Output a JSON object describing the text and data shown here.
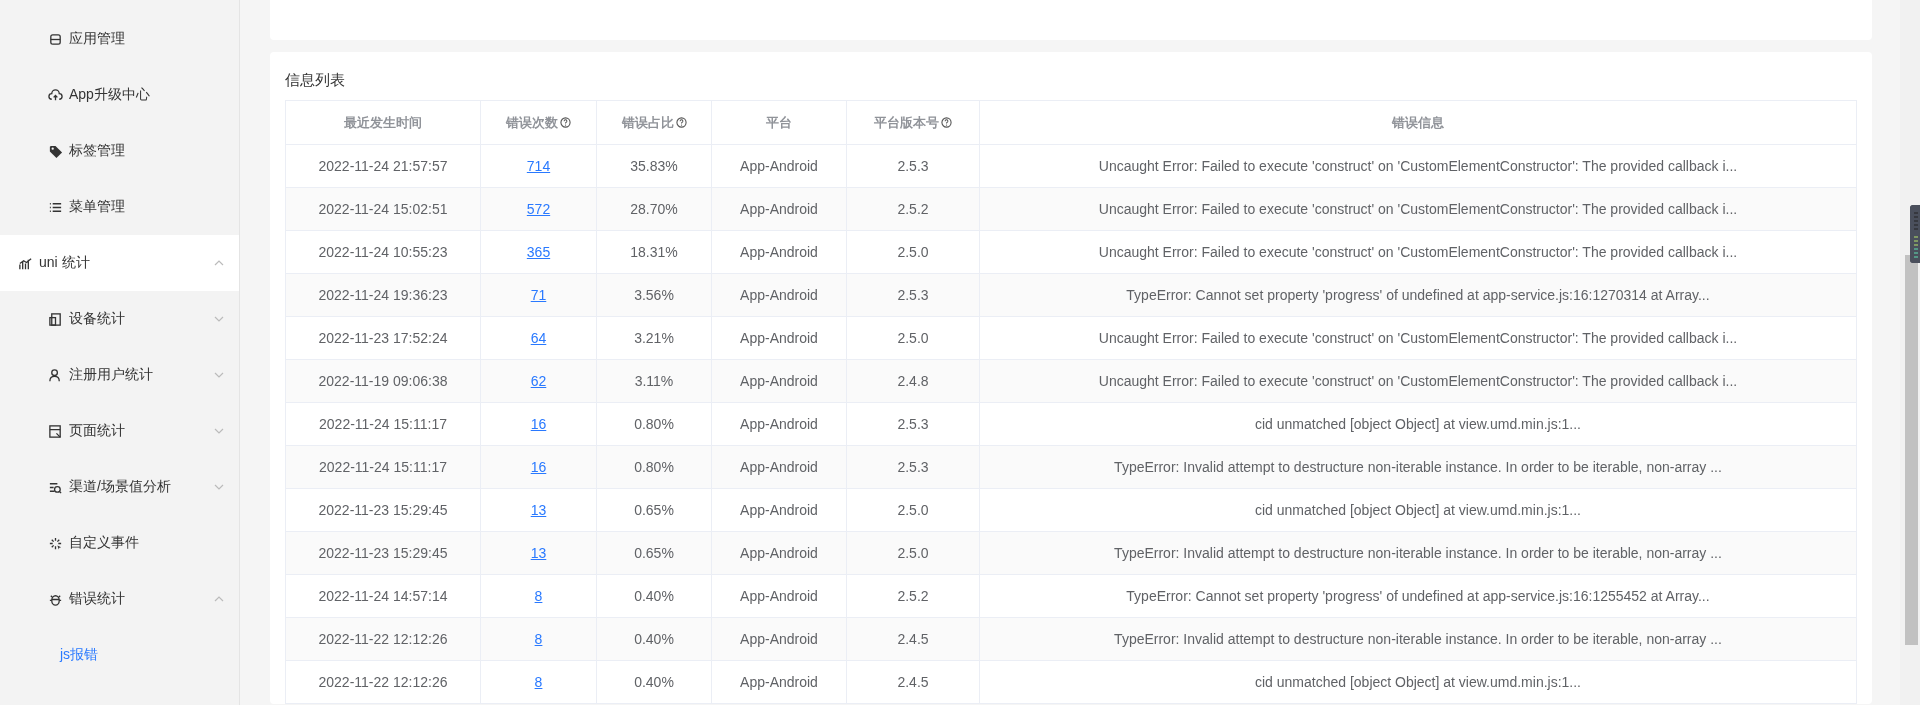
{
  "sidebar": {
    "items": [
      {
        "label": "应用管理",
        "kind": "link",
        "selected": false
      },
      {
        "label": "App升级中心",
        "kind": "link",
        "selected": false
      },
      {
        "label": "标签管理",
        "kind": "link",
        "selected": false
      },
      {
        "label": "菜单管理",
        "kind": "link",
        "selected": false
      },
      {
        "label": "uni 统计",
        "kind": "group",
        "selected": false,
        "expanded": true,
        "children": [
          {
            "label": "设备统计",
            "kind": "link",
            "selected": false,
            "expanded": false
          },
          {
            "label": "注册用户统计",
            "kind": "link",
            "selected": false,
            "expanded": false
          },
          {
            "label": "页面统计",
            "kind": "link",
            "selected": false,
            "expanded": false
          },
          {
            "label": "渠道/场景值分析",
            "kind": "link",
            "selected": false,
            "expanded": false
          },
          {
            "label": "自定义事件",
            "kind": "link",
            "selected": false
          },
          {
            "label": "错误统计",
            "kind": "link",
            "selected": false,
            "expanded": true,
            "children": [
              {
                "label": "js报错",
                "kind": "link",
                "selected": true
              }
            ]
          }
        ]
      }
    ]
  },
  "panel": {
    "title": "信息列表",
    "table": {
      "columns": [
        {
          "label": "最近发生时间",
          "help": false
        },
        {
          "label": "错误次数",
          "help": true
        },
        {
          "label": "错误占比",
          "help": true
        },
        {
          "label": "平台",
          "help": false
        },
        {
          "label": "平台版本号",
          "help": true
        },
        {
          "label": "错误信息",
          "help": false
        }
      ],
      "rows": [
        [
          "2022-11-24 21:57:57",
          "714",
          "35.83%",
          "App-Android",
          "2.5.3",
          "Uncaught Error: Failed to execute 'construct' on 'CustomElementConstructor': The provided callback i..."
        ],
        [
          "2022-11-24 15:02:51",
          "572",
          "28.70%",
          "App-Android",
          "2.5.2",
          "Uncaught Error: Failed to execute 'construct' on 'CustomElementConstructor': The provided callback i..."
        ],
        [
          "2022-11-24 10:55:23",
          "365",
          "18.31%",
          "App-Android",
          "2.5.0",
          "Uncaught Error: Failed to execute 'construct' on 'CustomElementConstructor': The provided callback i..."
        ],
        [
          "2022-11-24 19:36:23",
          "71",
          "3.56%",
          "App-Android",
          "2.5.3",
          "TypeError: Cannot set property 'progress' of undefined at app-service.js:16:1270314 at Array..."
        ],
        [
          "2022-11-23 17:52:24",
          "64",
          "3.21%",
          "App-Android",
          "2.5.0",
          "Uncaught Error: Failed to execute 'construct' on 'CustomElementConstructor': The provided callback i..."
        ],
        [
          "2022-11-19 09:06:38",
          "62",
          "3.11%",
          "App-Android",
          "2.4.8",
          "Uncaught Error: Failed to execute 'construct' on 'CustomElementConstructor': The provided callback i..."
        ],
        [
          "2022-11-24 15:11:17",
          "16",
          "0.80%",
          "App-Android",
          "2.5.3",
          "cid unmatched [object Object] at view.umd.min.js:1..."
        ],
        [
          "2022-11-24 15:11:17",
          "16",
          "0.80%",
          "App-Android",
          "2.5.3",
          "TypeError: Invalid attempt to destructure non-iterable instance. In order to be iterable, non-array ..."
        ],
        [
          "2022-11-23 15:29:45",
          "13",
          "0.65%",
          "App-Android",
          "2.5.0",
          "cid unmatched [object Object] at view.umd.min.js:1..."
        ],
        [
          "2022-11-23 15:29:45",
          "13",
          "0.65%",
          "App-Android",
          "2.5.0",
          "TypeError: Invalid attempt to destructure non-iterable instance. In order to be iterable, non-array ..."
        ],
        [
          "2022-11-24 14:57:14",
          "8",
          "0.40%",
          "App-Android",
          "2.5.2",
          "TypeError: Cannot set property 'progress' of undefined at app-service.js:16:1255452 at Array..."
        ],
        [
          "2022-11-22 12:12:26",
          "8",
          "0.40%",
          "App-Android",
          "2.4.5",
          "TypeError: Invalid attempt to destructure non-iterable instance. In order to be iterable, non-array ..."
        ],
        [
          "2022-11-22 12:12:26",
          "8",
          "0.40%",
          "App-Android",
          "2.4.5",
          "cid unmatched [object Object] at view.umd.min.js:1..."
        ]
      ]
    }
  }
}
